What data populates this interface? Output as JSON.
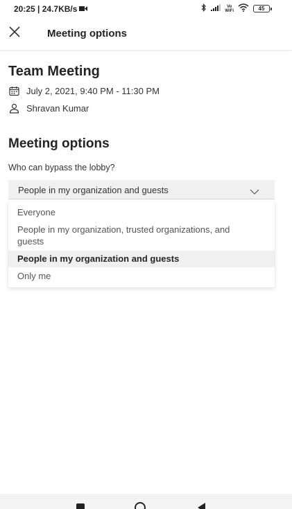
{
  "status_bar": {
    "time_speed": "20:25 | 24.7KB/s",
    "volte_label_top": "Vo",
    "volte_label_bottom": "WiFi",
    "battery": "45",
    "icons": [
      "video-camera-icon",
      "bluetooth-icon",
      "signal-icon",
      "volte-icon",
      "wifi-icon",
      "battery-icon"
    ]
  },
  "header": {
    "title": "Meeting options",
    "close_icon": "close-icon"
  },
  "meeting": {
    "title": "Team Meeting",
    "date_time": "July 2, 2021, 9:40 PM - 11:30 PM",
    "organizer": "Shravan Kumar",
    "date_icon": "calendar-icon",
    "organizer_icon": "person-icon"
  },
  "options": {
    "section_title": "Meeting options",
    "lobby_label": "Who can bypass the lobby?",
    "selected_value": "People in my organization and guests",
    "chevron_icon": "chevron-down-icon",
    "dropdown_items": [
      {
        "label": "Everyone",
        "selected": false
      },
      {
        "label": "People in my organization, trusted organizations, and guests",
        "selected": false
      },
      {
        "label": "People in my organization and guests",
        "selected": true
      },
      {
        "label": "Only me",
        "selected": false
      }
    ]
  },
  "nav_bar": {
    "icons": [
      "recent-apps-icon",
      "home-icon",
      "back-icon"
    ]
  },
  "colors": {
    "text_primary": "#242424",
    "selected_background": "#f0f0f0",
    "background": "#ffffff"
  }
}
